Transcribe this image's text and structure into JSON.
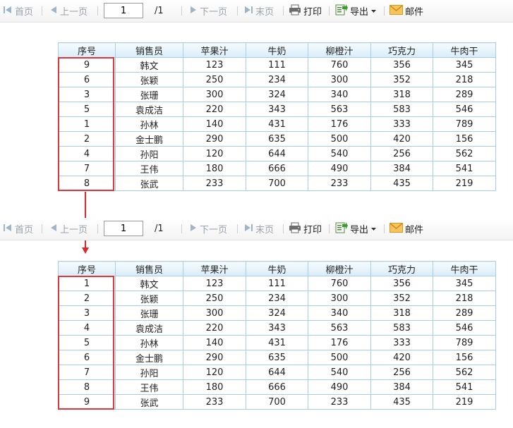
{
  "toolbar": {
    "first": "首页",
    "prev": "上一页",
    "page_value": "1",
    "page_total": "/1",
    "next": "下一页",
    "last": "末页",
    "print": "打印",
    "export": "导出",
    "mail": "邮件"
  },
  "columns": [
    "序号",
    "销售员",
    "苹果汁",
    "牛奶",
    "柳橙汁",
    "巧克力",
    "牛肉干"
  ],
  "table_before": [
    [
      "9",
      "韩文",
      "123",
      "111",
      "760",
      "356",
      "345"
    ],
    [
      "6",
      "张颖",
      "250",
      "234",
      "300",
      "352",
      "218"
    ],
    [
      "3",
      "张珊",
      "300",
      "324",
      "340",
      "318",
      "289"
    ],
    [
      "5",
      "袁成洁",
      "220",
      "343",
      "563",
      "583",
      "546"
    ],
    [
      "1",
      "孙林",
      "140",
      "431",
      "176",
      "333",
      "789"
    ],
    [
      "2",
      "金士鹏",
      "290",
      "635",
      "500",
      "420",
      "156"
    ],
    [
      "4",
      "孙阳",
      "120",
      "644",
      "540",
      "256",
      "562"
    ],
    [
      "7",
      "王伟",
      "180",
      "666",
      "490",
      "384",
      "541"
    ],
    [
      "8",
      "张武",
      "233",
      "700",
      "233",
      "435",
      "219"
    ]
  ],
  "table_after": [
    [
      "1",
      "韩文",
      "123",
      "111",
      "760",
      "356",
      "345"
    ],
    [
      "2",
      "张颖",
      "250",
      "234",
      "300",
      "352",
      "218"
    ],
    [
      "3",
      "张珊",
      "300",
      "324",
      "340",
      "318",
      "289"
    ],
    [
      "4",
      "袁成洁",
      "220",
      "343",
      "563",
      "583",
      "546"
    ],
    [
      "5",
      "孙林",
      "140",
      "431",
      "176",
      "333",
      "789"
    ],
    [
      "6",
      "金士鹏",
      "290",
      "635",
      "500",
      "420",
      "156"
    ],
    [
      "7",
      "孙阳",
      "120",
      "644",
      "540",
      "256",
      "562"
    ],
    [
      "8",
      "王伟",
      "180",
      "666",
      "490",
      "384",
      "541"
    ],
    [
      "9",
      "张武",
      "233",
      "700",
      "233",
      "435",
      "219"
    ]
  ],
  "colors": {
    "highlight": "#e0353a",
    "grid_border": "#a9cde6",
    "header_bg": "#d9ecf8",
    "disabled_text": "#9aa2aa"
  }
}
